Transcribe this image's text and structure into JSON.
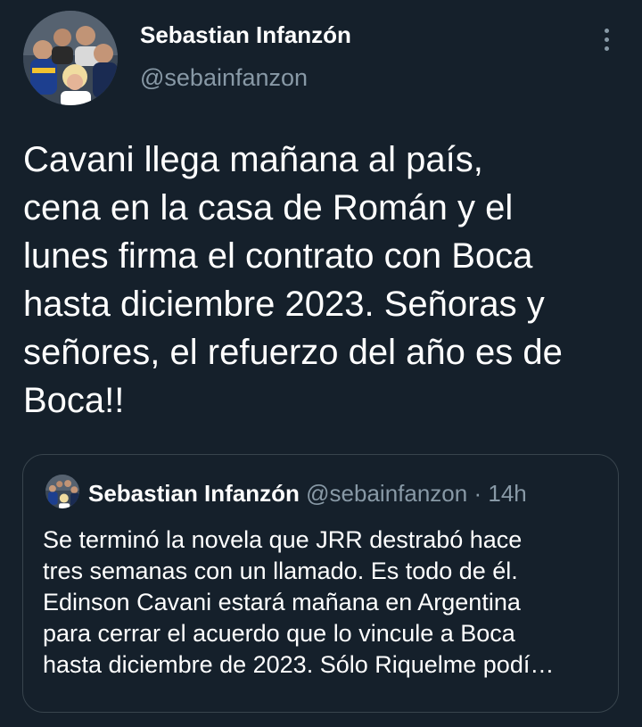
{
  "tweet": {
    "author_name": "Sebastian Infanzón",
    "author_handle": "@sebainfanzon",
    "text": "Cavani llega mañana al país,\ncena en la casa de Román y el\nlunes firma el contrato con Boca\nhasta diciembre 2023. Señoras y\nseñores, el refuerzo del año es de\nBoca!!"
  },
  "quote": {
    "author_name": "Sebastian Infanzón",
    "author_handle": "@sebainfanzon",
    "separator": "·",
    "time": "14h",
    "text": "Se terminó la novela que JRR destrabó hace\ntres semanas con un llamado. Es todo de él.\nEdinson Cavani estará mañana en Argentina\npara cerrar el acuerdo que lo vincule a Boca\nhasta diciembre de 2023. Sólo Riquelme podí…"
  },
  "icons": {
    "more": "more-vertical-icon"
  },
  "colors": {
    "background": "#15202b",
    "text_primary": "#ffffff",
    "text_secondary": "#8899a6",
    "border": "#38444d"
  }
}
